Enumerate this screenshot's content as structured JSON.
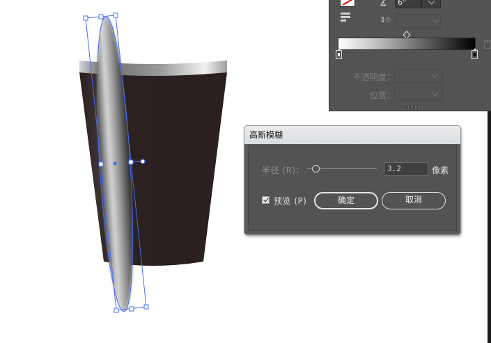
{
  "gradient_panel": {
    "angle_value": "6°",
    "opacity_label": "不透明度：",
    "location_label": "位置："
  },
  "dialog": {
    "title": "高斯模糊",
    "radius_label": "半径 (R)：",
    "radius_value": "3.2",
    "radius_unit": "像素",
    "preview_label": "预览 (P)",
    "preview_checked": true,
    "ok_label": "确定",
    "cancel_label": "取消"
  },
  "colors": {
    "cup_body": "#2b2120",
    "selection": "#4a6cf0",
    "panel_bg": "#535353",
    "dialog_title_bg": "#dde1e7"
  }
}
